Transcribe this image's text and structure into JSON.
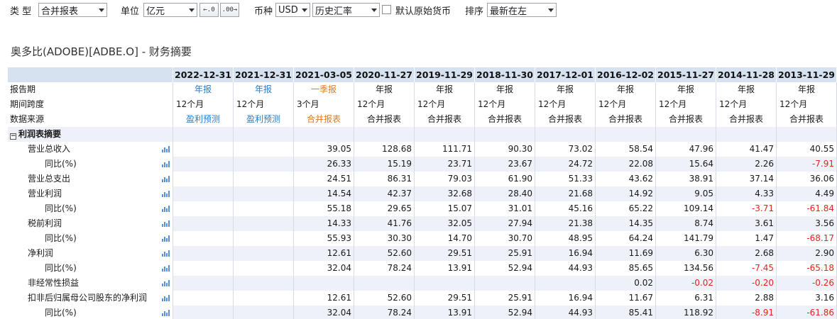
{
  "toolbar": {
    "type_label": "类  型",
    "type_value": "合并报表",
    "unit_label": "单位",
    "unit_value": "亿元",
    "currency_label": "币种",
    "currency_value": "USD",
    "rate_value": "历史汇率",
    "default_currency_label": "默认原始货币",
    "sort_label": "排序",
    "sort_value": "最新在左",
    "decimal_dec_icon": "←.0",
    "decimal_inc_icon": ".00→"
  },
  "title": "奥多比(ADOBE)[ADBE.O] - 财务摘要",
  "colors": {
    "blue": "#2a7ec6",
    "orange": "#e07b1c",
    "negative": "#e8211d",
    "header_bg": "#d7e2f0",
    "alt_row": "#eef1f8"
  },
  "columns": [
    {
      "date": "2022-12-31",
      "period": "年报",
      "span": "12个月",
      "source": "盈利预测",
      "color": "blue"
    },
    {
      "date": "2021-12-31",
      "period": "年报",
      "span": "12个月",
      "source": "盈利预测",
      "color": "blue"
    },
    {
      "date": "2021-03-05",
      "period": "一季报",
      "span": "3个月",
      "source": "合并报表",
      "color": "orange"
    },
    {
      "date": "2020-11-27",
      "period": "年报",
      "span": "12个月",
      "source": "合并报表",
      "color": ""
    },
    {
      "date": "2019-11-29",
      "period": "年报",
      "span": "12个月",
      "source": "合并报表",
      "color": ""
    },
    {
      "date": "2018-11-30",
      "period": "年报",
      "span": "12个月",
      "source": "合并报表",
      "color": ""
    },
    {
      "date": "2017-12-01",
      "period": "年报",
      "span": "12个月",
      "source": "合并报表",
      "color": ""
    },
    {
      "date": "2016-12-02",
      "period": "年报",
      "span": "12个月",
      "source": "合并报表",
      "color": ""
    },
    {
      "date": "2015-11-27",
      "period": "年报",
      "span": "12个月",
      "source": "合并报表",
      "color": ""
    },
    {
      "date": "2014-11-28",
      "period": "年报",
      "span": "12个月",
      "source": "合并报表",
      "color": ""
    },
    {
      "date": "2013-11-29",
      "period": "年报",
      "span": "12个月",
      "source": "合并报表",
      "color": ""
    }
  ],
  "meta_rows": {
    "period_label": "报告期",
    "span_label": "期间跨度",
    "source_label": "数据来源"
  },
  "section": {
    "label": "利润表摘要",
    "expander": "−"
  },
  "rows": [
    {
      "label": "营业总收入",
      "indent": 1,
      "values": [
        "",
        "",
        "39.05",
        "128.68",
        "111.71",
        "90.30",
        "73.02",
        "58.54",
        "47.96",
        "41.47",
        "40.55"
      ]
    },
    {
      "label": "同比(%)",
      "indent": 2,
      "values": [
        "",
        "",
        "26.33",
        "15.19",
        "23.71",
        "23.67",
        "24.72",
        "22.08",
        "15.64",
        "2.26",
        "-7.91"
      ]
    },
    {
      "label": "营业总支出",
      "indent": 1,
      "values": [
        "",
        "",
        "24.51",
        "86.31",
        "79.03",
        "61.90",
        "51.33",
        "43.62",
        "38.91",
        "37.14",
        "36.06"
      ]
    },
    {
      "label": "营业利润",
      "indent": 1,
      "values": [
        "",
        "",
        "14.54",
        "42.37",
        "32.68",
        "28.40",
        "21.68",
        "14.92",
        "9.05",
        "4.33",
        "4.49"
      ]
    },
    {
      "label": "同比(%)",
      "indent": 2,
      "values": [
        "",
        "",
        "55.18",
        "29.65",
        "15.07",
        "31.01",
        "45.16",
        "65.22",
        "109.14",
        "-3.71",
        "-61.84"
      ]
    },
    {
      "label": "税前利润",
      "indent": 1,
      "values": [
        "",
        "",
        "14.33",
        "41.76",
        "32.05",
        "27.94",
        "21.38",
        "14.35",
        "8.74",
        "3.61",
        "3.56"
      ]
    },
    {
      "label": "同比(%)",
      "indent": 2,
      "values": [
        "",
        "",
        "55.93",
        "30.30",
        "14.70",
        "30.70",
        "48.95",
        "64.24",
        "141.79",
        "1.47",
        "-68.17"
      ]
    },
    {
      "label": "净利润",
      "indent": 1,
      "values": [
        "",
        "",
        "12.61",
        "52.60",
        "29.51",
        "25.91",
        "16.94",
        "11.69",
        "6.30",
        "2.68",
        "2.90"
      ]
    },
    {
      "label": "同比(%)",
      "indent": 2,
      "values": [
        "",
        "",
        "32.04",
        "78.24",
        "13.91",
        "52.94",
        "44.93",
        "85.65",
        "134.56",
        "-7.45",
        "-65.18"
      ]
    },
    {
      "label": "非经常性损益",
      "indent": 1,
      "values": [
        "",
        "",
        "",
        "",
        "",
        "",
        "",
        "0.02",
        "-0.02",
        "-0.20",
        "-0.26"
      ]
    },
    {
      "label": "扣非后归属母公司股东的净利润",
      "indent": 1,
      "values": [
        "",
        "",
        "12.61",
        "52.60",
        "29.51",
        "25.91",
        "16.94",
        "11.67",
        "6.31",
        "2.88",
        "3.16"
      ]
    },
    {
      "label": "同比(%)",
      "indent": 2,
      "values": [
        "",
        "",
        "32.04",
        "78.24",
        "13.91",
        "52.94",
        "44.93",
        "85.41",
        "118.92",
        "-8.91",
        "-61.86"
      ]
    }
  ]
}
